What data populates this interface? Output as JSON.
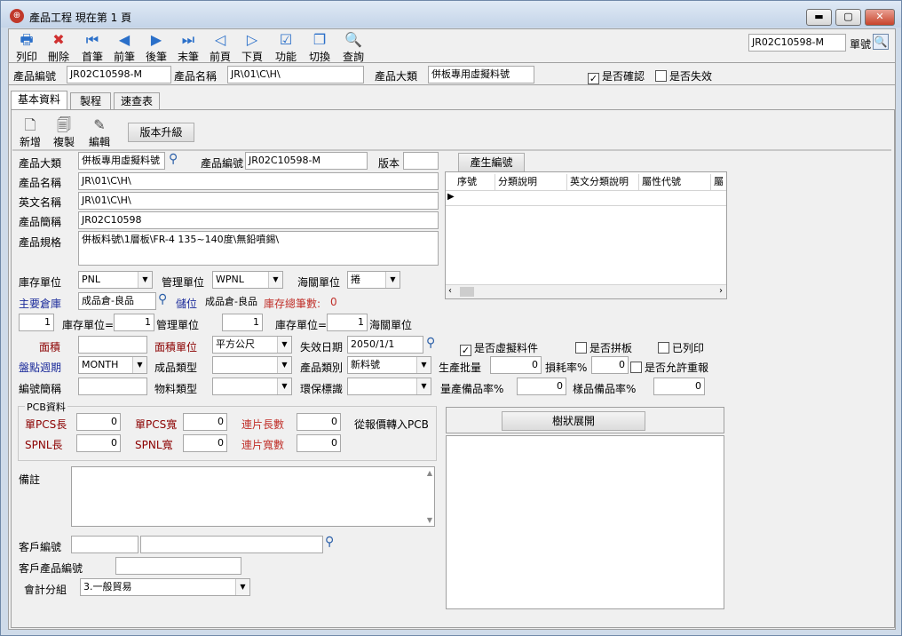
{
  "window": {
    "title": "產品工程 現在第 1 頁",
    "min": "▬",
    "max": "▢",
    "close": "✕"
  },
  "toolbar": {
    "buttons": [
      {
        "label": "列印",
        "icon": "printer-icon",
        "glyph": "🖶"
      },
      {
        "label": "刪除",
        "icon": "delete-icon",
        "glyph": "✖"
      },
      {
        "label": "首筆",
        "icon": "first-record-icon",
        "glyph": "⏮"
      },
      {
        "label": "前筆",
        "icon": "prev-record-icon",
        "glyph": "◀"
      },
      {
        "label": "後筆",
        "icon": "next-record-icon",
        "glyph": "▶"
      },
      {
        "label": "末筆",
        "icon": "last-record-icon",
        "glyph": "⏭"
      },
      {
        "label": "前頁",
        "icon": "prev-page-icon",
        "glyph": "◁"
      },
      {
        "label": "下頁",
        "icon": "next-page-icon",
        "glyph": "▷"
      },
      {
        "label": "功能",
        "icon": "function-icon",
        "glyph": "☑"
      },
      {
        "label": "切換",
        "icon": "switch-icon",
        "glyph": "❐"
      },
      {
        "label": "查詢",
        "icon": "query-icon",
        "glyph": "🔍"
      }
    ],
    "doc_no_value": "JR02C10598-M",
    "doc_no_label": "單號"
  },
  "header": {
    "product_code_label": "產品編號",
    "product_code": "JR02C10598-M",
    "product_name_label": "產品名稱",
    "product_name": "JR\\01\\C\\H\\",
    "category_label": "產品大類",
    "category": "併板專用虛擬料號",
    "confirmed_label": "是否確認",
    "invalid_label": "是否失效"
  },
  "tabs": [
    "基本資料",
    "製程",
    "速查表"
  ],
  "subtoolbar": {
    "new": "新增",
    "copy": "複製",
    "edit": "編輯",
    "upgrade": "版本升級"
  },
  "form": {
    "category_label": "產品大類",
    "category": "併板專用虛擬料號",
    "code_label": "產品編號",
    "code": "JR02C10598-M",
    "version_label": "版本",
    "version": "",
    "gen_code_button": "產生編號",
    "name_label": "產品名稱",
    "name": "JR\\01\\C\\H\\",
    "en_name_label": "英文名稱",
    "en_name": "JR\\01\\C\\H\\",
    "short_name_label": "產品簡稱",
    "short_name": "JR02C10598",
    "spec_label": "產品規格",
    "spec": "併板料號\\1層板\\FR-4 135~140度\\無鉛噴錫\\",
    "stock_unit_label": "庫存單位",
    "stock_unit": "PNL",
    "mgmt_unit_label": "管理單位",
    "mgmt_unit": "WPNL",
    "customs_unit_label": "海關單位",
    "customs_unit": "捲",
    "main_wh_label": "主要倉庫",
    "main_wh": "成品倉-良品",
    "location_label": "儲位",
    "location": "成品倉-良品",
    "stock_total_label": "庫存總筆數:",
    "stock_total": "0",
    "conv1": "1",
    "conv_stock_label1": "庫存單位=",
    "conv2": "1",
    "conv_mgmt_label": "管理單位",
    "conv3": "1",
    "conv_stock_label2": "庫存單位=",
    "conv4": "1",
    "conv_customs_label": "海關單位",
    "area_label": "面積",
    "area": "",
    "area_unit_label": "面積單位",
    "area_unit": "平方公尺",
    "expire_label": "失效日期",
    "expire": "2050/1/1",
    "virtual_label": "是否虛擬料件",
    "panel_label": "是否拼板",
    "printed_label": "已列印",
    "cycle_label": "盤點週期",
    "cycle": "MONTH",
    "prod_type_label": "成品類型",
    "prod_type": "",
    "prod_class_label": "產品類別",
    "prod_class": "新料號",
    "batch_label": "生產批量",
    "batch": "0",
    "loss_label": "損耗率%",
    "loss": "0",
    "allow_over_label": "是否允許重報",
    "code_abbr_label": "編號簡稱",
    "code_abbr": "",
    "mat_type_label": "物料類型",
    "mat_type": "",
    "eco_label": "環保標識",
    "eco": "",
    "mass_spare_label": "量產備品率%",
    "mass_spare": "0",
    "sample_spare_label": "樣品備品率%",
    "sample_spare": "0"
  },
  "grid": {
    "columns": [
      "序號",
      "分類說明",
      "英文分類說明",
      "屬性代號",
      "屬"
    ]
  },
  "pcb": {
    "title": "PCB資料",
    "pcs_len_label": "單PCS長",
    "pcs_len": "0",
    "pcs_wid_label": "單PCS寬",
    "pcs_wid": "0",
    "conn_len_label": "連片長數",
    "conn_len": "0",
    "import_label": "從報價轉入PCB",
    "spnl_len_label": "SPNL長",
    "spnl_len": "0",
    "spnl_wid_label": "SPNL寬",
    "spnl_wid": "0",
    "conn_wid_label": "連片寬數",
    "conn_wid": "0"
  },
  "tree_button": "樹狀展開",
  "remark_label": "備註",
  "customer": {
    "code_label": "客戶編號",
    "code": "",
    "name": "",
    "prod_code_label": "客戶產品編號",
    "prod_code": "",
    "acct_group_label": "會計分組",
    "acct_group": "3.一般貿易"
  }
}
